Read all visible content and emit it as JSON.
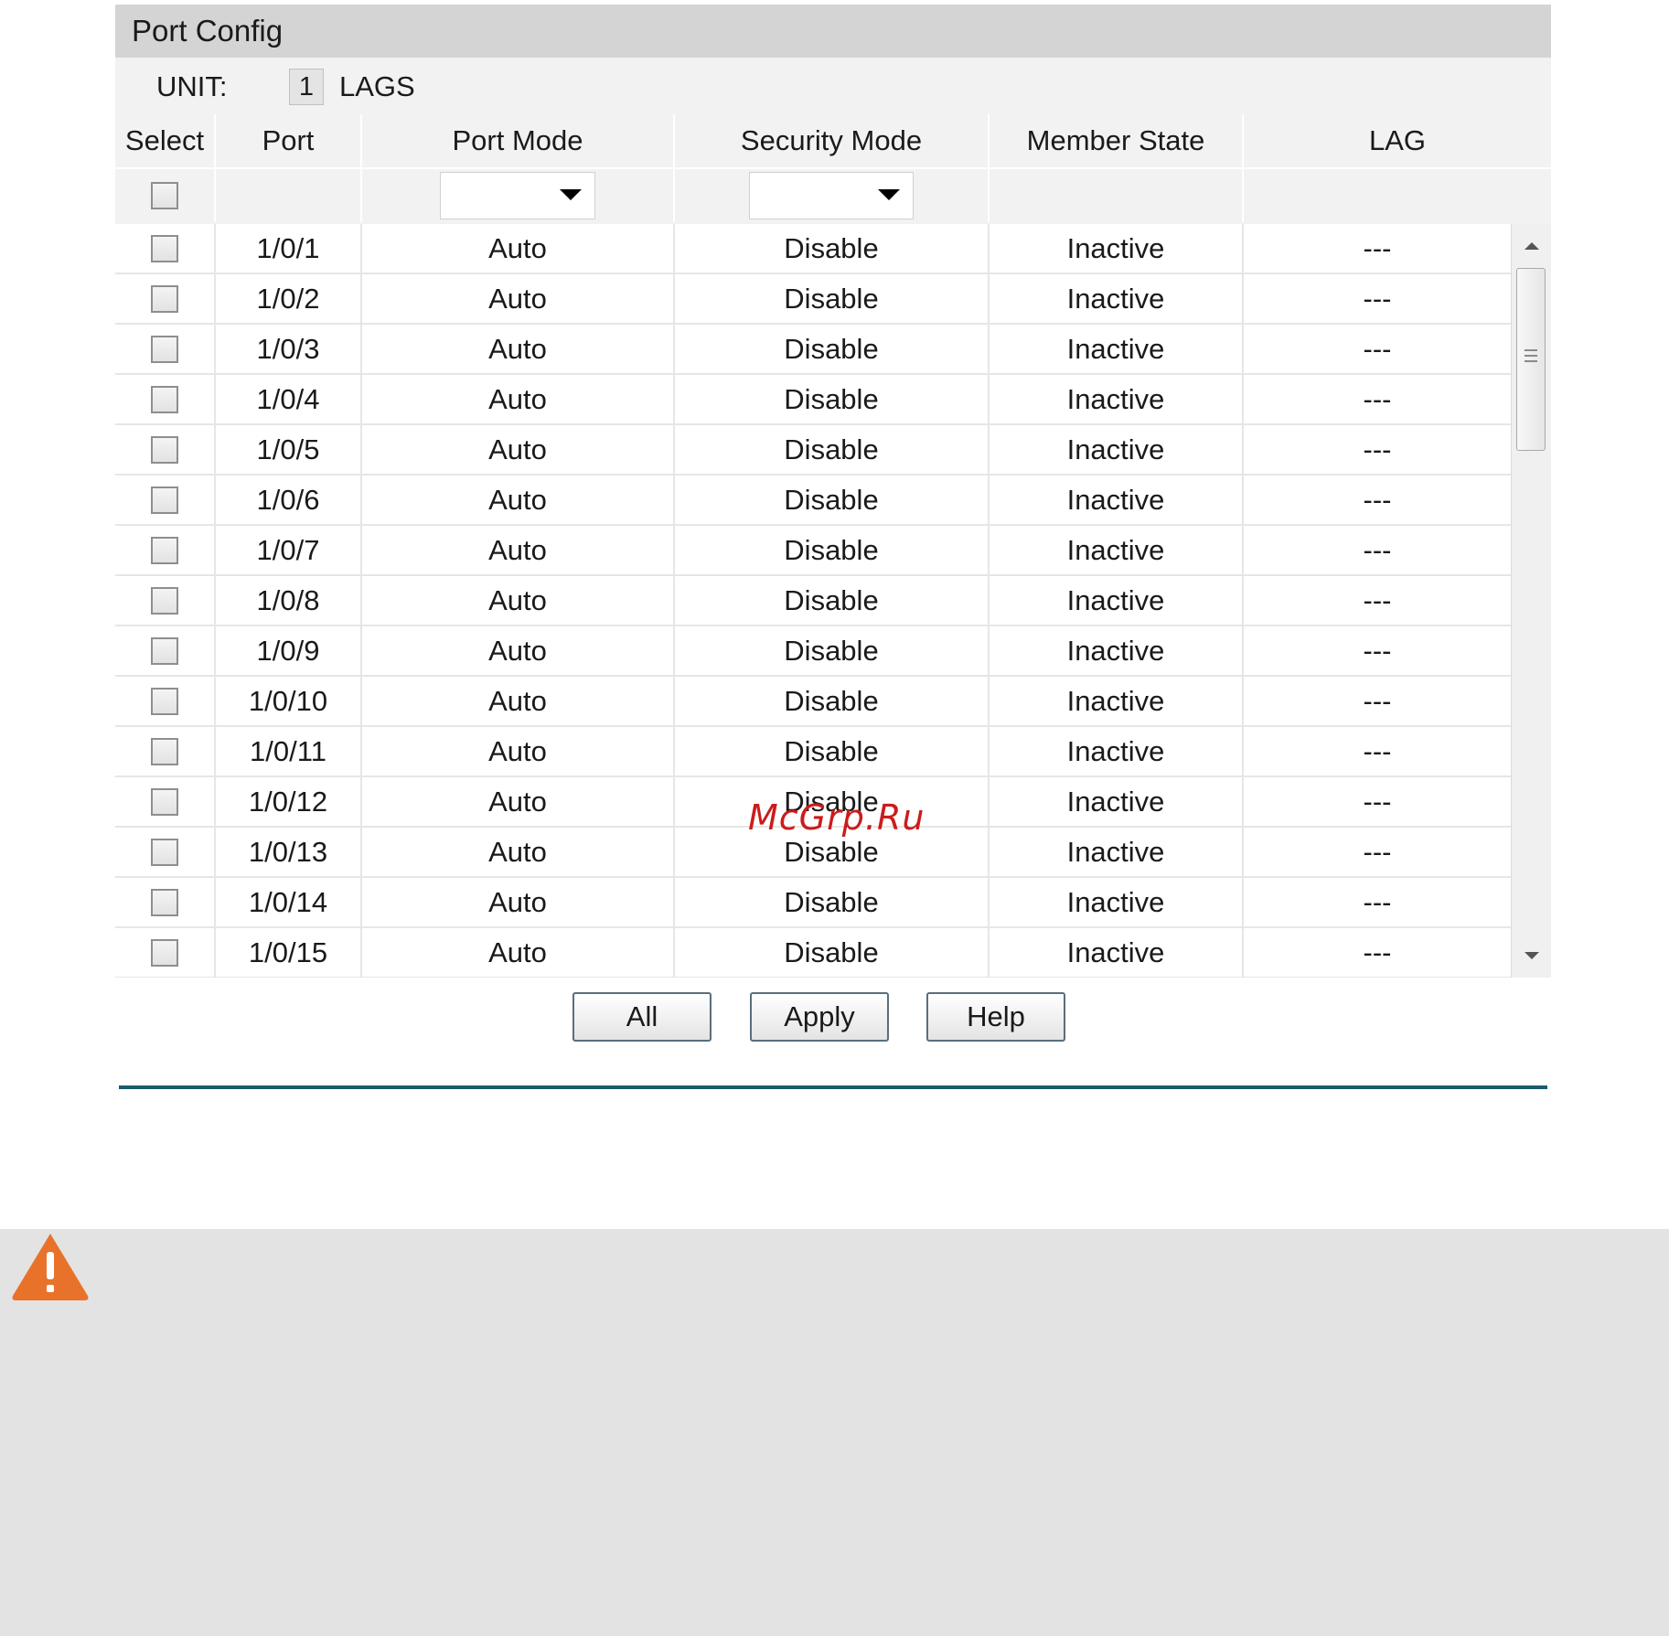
{
  "panel": {
    "title": "Port Config",
    "unit_label": "UNIT:",
    "unit_value": "1",
    "lags_label": "LAGS"
  },
  "table": {
    "columns": [
      "Select",
      "Port",
      "Port Mode",
      "Security Mode",
      "Member State",
      "LAG"
    ],
    "rows": [
      {
        "port": "1/0/1",
        "port_mode": "Auto",
        "security_mode": "Disable",
        "member_state": "Inactive",
        "lag": "---"
      },
      {
        "port": "1/0/2",
        "port_mode": "Auto",
        "security_mode": "Disable",
        "member_state": "Inactive",
        "lag": "---"
      },
      {
        "port": "1/0/3",
        "port_mode": "Auto",
        "security_mode": "Disable",
        "member_state": "Inactive",
        "lag": "---"
      },
      {
        "port": "1/0/4",
        "port_mode": "Auto",
        "security_mode": "Disable",
        "member_state": "Inactive",
        "lag": "---"
      },
      {
        "port": "1/0/5",
        "port_mode": "Auto",
        "security_mode": "Disable",
        "member_state": "Inactive",
        "lag": "---"
      },
      {
        "port": "1/0/6",
        "port_mode": "Auto",
        "security_mode": "Disable",
        "member_state": "Inactive",
        "lag": "---"
      },
      {
        "port": "1/0/7",
        "port_mode": "Auto",
        "security_mode": "Disable",
        "member_state": "Inactive",
        "lag": "---"
      },
      {
        "port": "1/0/8",
        "port_mode": "Auto",
        "security_mode": "Disable",
        "member_state": "Inactive",
        "lag": "---"
      },
      {
        "port": "1/0/9",
        "port_mode": "Auto",
        "security_mode": "Disable",
        "member_state": "Inactive",
        "lag": "---"
      },
      {
        "port": "1/0/10",
        "port_mode": "Auto",
        "security_mode": "Disable",
        "member_state": "Inactive",
        "lag": "---"
      },
      {
        "port": "1/0/11",
        "port_mode": "Auto",
        "security_mode": "Disable",
        "member_state": "Inactive",
        "lag": "---"
      },
      {
        "port": "1/0/12",
        "port_mode": "Auto",
        "security_mode": "Disable",
        "member_state": "Inactive",
        "lag": "---"
      },
      {
        "port": "1/0/13",
        "port_mode": "Auto",
        "security_mode": "Disable",
        "member_state": "Inactive",
        "lag": "---"
      },
      {
        "port": "1/0/14",
        "port_mode": "Auto",
        "security_mode": "Disable",
        "member_state": "Inactive",
        "lag": "---"
      },
      {
        "port": "1/0/15",
        "port_mode": "Auto",
        "security_mode": "Disable",
        "member_state": "Inactive",
        "lag": "---"
      }
    ]
  },
  "buttons": {
    "all": "All",
    "apply": "Apply",
    "help": "Help"
  },
  "watermark": "McGrp.Ru",
  "icons": {
    "warning": "warning-icon",
    "dropdown": "chevron-down-icon",
    "scroll_up": "arrow-up-icon",
    "scroll_down": "arrow-down-icon"
  },
  "colors": {
    "title_bar": "#d4d4d4",
    "divider": "#1d5a6b",
    "warning": "#e9722b",
    "watermark": "#cc1b1b",
    "note_background": "#e3e3e3"
  }
}
